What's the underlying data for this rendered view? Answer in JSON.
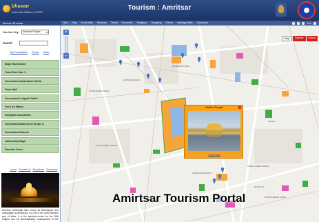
{
  "header": {
    "logo_name": "bhuvan",
    "logo_sub": "Indian Geo-Platform of ISRO",
    "title": "Tourism : Amritsar"
  },
  "menubar": {
    "brand": "Bhuvan Bhuvala",
    "items": [
      "Bird",
      "Stay",
      "Food Halts",
      "Services",
      "Travel",
      "Economic",
      "Religious",
      "Shopping",
      "Others",
      "Heritage Walk",
      "Download"
    ],
    "tool_label": "Tool"
  },
  "sidebar": {
    "city_label": "See the City",
    "city_value": "Amritsar Punjab",
    "search_label": "Search",
    "search_value": "",
    "links": [
      "Top Destination",
      "Travel",
      "Hotel"
    ],
    "poi_items": [
      "Bagh Rameswori",
      "Tuba Bhai Sab. X",
      "Gurudwara Santokhsar Sahib",
      "Town Hall",
      "Gurudwara Lohgarh Sahib",
      "Guru Ka Mahal",
      "Durgiana Gurudwara",
      "Gurudwara Baba Deep Singh Ji",
      "Gurudwara Ramsar",
      "Jallianwala Bagh",
      "Darshini Deori"
    ],
    "footer_links": [
      "Loved",
      "Contact Us",
      "Disclaimer",
      "Feedback"
    ],
    "description": "Amritsar historically also known as Rāmdāspur and colloquially as Ambarsar, is a city in the north-western part of India. It is the spiritual center for the Sikh religion and the administrative headquarters of the Amritsar district in the state of Punjab."
  },
  "map": {
    "tabs": [
      "Map",
      "Satellite",
      "Hybrid"
    ],
    "zoom_in": "+",
    "zoom_out": "−",
    "labels": [
      "KATRA SHER SINGH",
      "KATRA BHAGIAN",
      "KATRA JAIMAL SINGH",
      "KATRA JAIMAL SINGH",
      "MOHALLA",
      "KUCHA",
      "KATRA MOTI RAM",
      "KATRA KARAM SINGH",
      "KATRA AHLUWALIA"
    ],
    "popup": {
      "title": "Golden Temple",
      "close": "x",
      "link": "Know more"
    }
  },
  "overlay_title": "Amirtsar Tourism Portal",
  "colors": {
    "header": "#2d4d87",
    "menubar": "#3e5f9a",
    "poi_item": "#b9d6ae",
    "popup": "#f7a21a",
    "map_tab_active": "#d2221f",
    "marker": "#3d77c9"
  }
}
